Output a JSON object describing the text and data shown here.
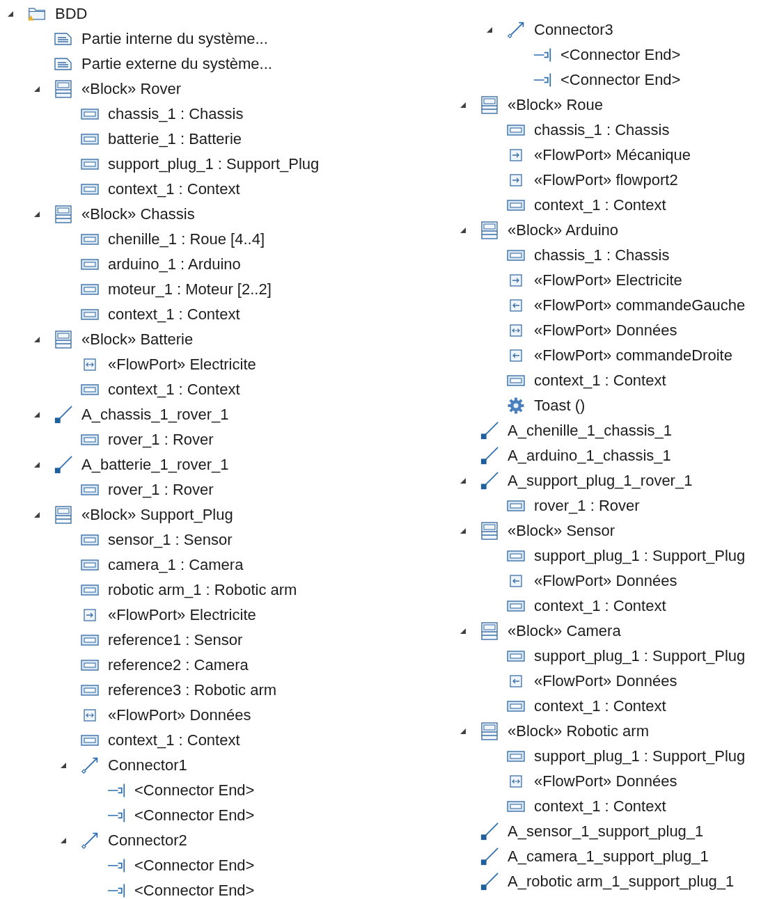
{
  "tree": {
    "columns": [
      {
        "nodes": [
          {
            "kind": "folder",
            "label": "BDD",
            "expanded": true,
            "children": [
              {
                "kind": "diagram",
                "label": "Partie interne du système..."
              },
              {
                "kind": "diagram",
                "label": "Partie externe du système..."
              },
              {
                "kind": "block",
                "label": "«Block» Rover",
                "expanded": true,
                "children": [
                  {
                    "kind": "part",
                    "label": "chassis_1 : Chassis"
                  },
                  {
                    "kind": "part",
                    "label": "batterie_1 : Batterie"
                  },
                  {
                    "kind": "part",
                    "label": "support_plug_1 : Support_Plug"
                  },
                  {
                    "kind": "part",
                    "label": "context_1 : Context"
                  }
                ]
              },
              {
                "kind": "block",
                "label": "«Block» Chassis",
                "expanded": true,
                "children": [
                  {
                    "kind": "part",
                    "label": "chenille_1 : Roue [4..4]"
                  },
                  {
                    "kind": "part",
                    "label": "arduino_1 : Arduino"
                  },
                  {
                    "kind": "part",
                    "label": "moteur_1 : Moteur [2..2]"
                  },
                  {
                    "kind": "part",
                    "label": "context_1 : Context"
                  }
                ]
              },
              {
                "kind": "block",
                "label": "«Block» Batterie",
                "expanded": true,
                "children": [
                  {
                    "kind": "port_inout",
                    "label": "«FlowPort» Electricite"
                  },
                  {
                    "kind": "part",
                    "label": "context_1 : Context"
                  }
                ]
              },
              {
                "kind": "association",
                "label": "A_chassis_1_rover_1",
                "expanded": true,
                "children": [
                  {
                    "kind": "part",
                    "label": "rover_1 : Rover"
                  }
                ]
              },
              {
                "kind": "association",
                "label": "A_batterie_1_rover_1",
                "expanded": true,
                "children": [
                  {
                    "kind": "part",
                    "label": "rover_1 : Rover"
                  }
                ]
              },
              {
                "kind": "block",
                "label": "«Block» Support_Plug",
                "expanded": true,
                "children": [
                  {
                    "kind": "part",
                    "label": "sensor_1 : Sensor"
                  },
                  {
                    "kind": "part",
                    "label": "camera_1 : Camera"
                  },
                  {
                    "kind": "part",
                    "label": "robotic arm_1 : Robotic arm"
                  },
                  {
                    "kind": "port_out",
                    "label": "«FlowPort» Electricite"
                  },
                  {
                    "kind": "part",
                    "label": "reference1 : Sensor"
                  },
                  {
                    "kind": "part",
                    "label": "reference2 : Camera"
                  },
                  {
                    "kind": "part",
                    "label": "reference3 : Robotic arm"
                  },
                  {
                    "kind": "port_inout",
                    "label": "«FlowPort» Données"
                  },
                  {
                    "kind": "part",
                    "label": "context_1 : Context"
                  },
                  {
                    "kind": "connector",
                    "label": "Connector1",
                    "expanded": true,
                    "children": [
                      {
                        "kind": "connector_end",
                        "label": "<Connector End>"
                      },
                      {
                        "kind": "connector_end",
                        "label": "<Connector End>"
                      }
                    ]
                  },
                  {
                    "kind": "connector",
                    "label": "Connector2",
                    "expanded": true,
                    "children": [
                      {
                        "kind": "connector_end",
                        "label": "<Connector End>"
                      },
                      {
                        "kind": "connector_end",
                        "label": "<Connector End>"
                      }
                    ]
                  }
                ]
              }
            ]
          }
        ]
      },
      {
        "continued": [
          {
            "kind": "connector",
            "label": "Connector3",
            "expanded": true,
            "children": [
              {
                "kind": "connector_end",
                "label": "<Connector End>"
              },
              {
                "kind": "connector_end",
                "label": "<Connector End>"
              }
            ]
          }
        ],
        "nodes": [
          {
            "kind": "block",
            "label": "«Block» Roue",
            "expanded": true,
            "children": [
              {
                "kind": "part",
                "label": "chassis_1 : Chassis"
              },
              {
                "kind": "port_out",
                "label": "«FlowPort» Mécanique"
              },
              {
                "kind": "port_out",
                "label": "«FlowPort» flowport2"
              },
              {
                "kind": "part",
                "label": "context_1 : Context"
              }
            ]
          },
          {
            "kind": "block",
            "label": "«Block» Arduino",
            "expanded": true,
            "children": [
              {
                "kind": "part",
                "label": "chassis_1 : Chassis"
              },
              {
                "kind": "port_out",
                "label": "«FlowPort» Electricite"
              },
              {
                "kind": "port_in",
                "label": "«FlowPort» commandeGauche"
              },
              {
                "kind": "port_inout",
                "label": "«FlowPort» Données"
              },
              {
                "kind": "port_in",
                "label": "«FlowPort» commandeDroite"
              },
              {
                "kind": "part",
                "label": "context_1 : Context"
              },
              {
                "kind": "operation",
                "label": "Toast ()"
              }
            ]
          },
          {
            "kind": "association",
            "label": "A_chenille_1_chassis_1"
          },
          {
            "kind": "association",
            "label": "A_arduino_1_chassis_1"
          },
          {
            "kind": "association",
            "label": "A_support_plug_1_rover_1",
            "expanded": true,
            "children": [
              {
                "kind": "part",
                "label": "rover_1 : Rover"
              }
            ]
          },
          {
            "kind": "block",
            "label": "«Block» Sensor",
            "expanded": true,
            "children": [
              {
                "kind": "part",
                "label": "support_plug_1 : Support_Plug"
              },
              {
                "kind": "port_in",
                "label": "«FlowPort» Données"
              },
              {
                "kind": "part",
                "label": "context_1 : Context"
              }
            ]
          },
          {
            "kind": "block",
            "label": "«Block» Camera",
            "expanded": true,
            "children": [
              {
                "kind": "part",
                "label": "support_plug_1 : Support_Plug"
              },
              {
                "kind": "port_in",
                "label": "«FlowPort» Données"
              },
              {
                "kind": "part",
                "label": "context_1 : Context"
              }
            ]
          },
          {
            "kind": "block",
            "label": "«Block» Robotic arm",
            "expanded": true,
            "children": [
              {
                "kind": "part",
                "label": "support_plug_1 : Support_Plug"
              },
              {
                "kind": "port_inout",
                "label": "«FlowPort» Données"
              },
              {
                "kind": "part",
                "label": "context_1 : Context"
              }
            ]
          },
          {
            "kind": "association",
            "label": "A_sensor_1_support_plug_1"
          },
          {
            "kind": "association",
            "label": "A_camera_1_support_plug_1"
          },
          {
            "kind": "association",
            "label": "A_robotic arm_1_support_plug_1"
          }
        ]
      }
    ]
  }
}
